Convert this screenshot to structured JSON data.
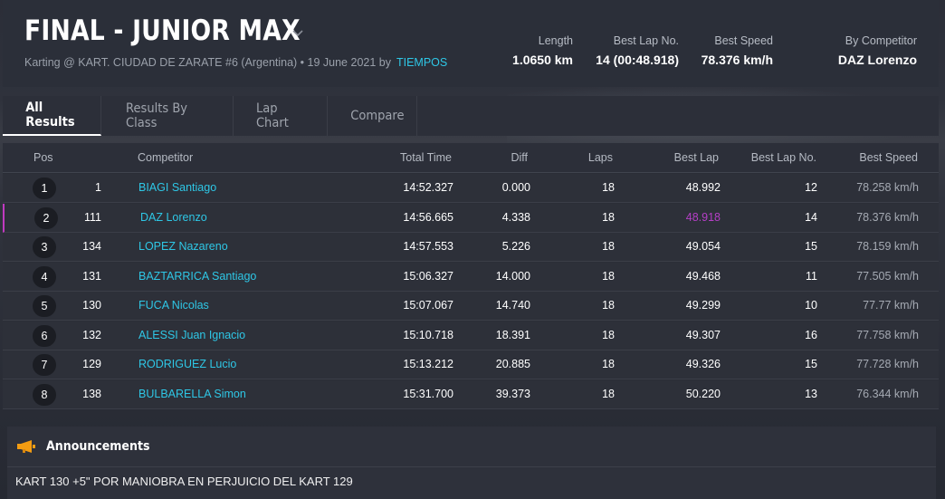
{
  "event": {
    "title": "FINAL - JUNIOR MAX",
    "subtitle": "Karting @ KART. CIUDAD DE ZARATE #6 (Argentina) • 19 June 2021 by",
    "subtitle_link": "TIEMPOS"
  },
  "stats": {
    "length_label": "Length",
    "length_value": "1.0650 km",
    "best_lap_no_label": "Best Lap No.",
    "best_lap_no_value": "14 (00:48.918)",
    "best_speed_label": "Best Speed",
    "best_speed_value": "78.376 km/h",
    "by_competitor_label": "By Competitor",
    "by_competitor_value": "DAZ Lorenzo"
  },
  "tabs": [
    "All Results",
    "Results By Class",
    "Lap Chart",
    "Compare"
  ],
  "table": {
    "headers": {
      "pos": "Pos",
      "competitor": "Competitor",
      "total_time": "Total Time",
      "diff": "Diff",
      "laps": "Laps",
      "best_lap": "Best Lap",
      "best_lap_no": "Best Lap No.",
      "best_speed": "Best Speed"
    },
    "rows": [
      {
        "pos": "1",
        "no": "1",
        "competitor": "BIAGI Santiago",
        "total_time": "14:52.327",
        "diff": "0.000",
        "laps": "18",
        "best_lap": "48.992",
        "best_lap_no": "12",
        "best_speed": "78.258 km/h"
      },
      {
        "pos": "2",
        "no": "111",
        "competitor": "DAZ Lorenzo",
        "total_time": "14:56.665",
        "diff": "4.338",
        "laps": "18",
        "best_lap": "48.918",
        "best_lap_no": "14",
        "best_speed": "78.376 km/h"
      },
      {
        "pos": "3",
        "no": "134",
        "competitor": "LOPEZ Nazareno",
        "total_time": "14:57.553",
        "diff": "5.226",
        "laps": "18",
        "best_lap": "49.054",
        "best_lap_no": "15",
        "best_speed": "78.159 km/h"
      },
      {
        "pos": "4",
        "no": "131",
        "competitor": "BAZTARRICA Santiago",
        "total_time": "15:06.327",
        "diff": "14.000",
        "laps": "18",
        "best_lap": "49.468",
        "best_lap_no": "11",
        "best_speed": "77.505 km/h"
      },
      {
        "pos": "5",
        "no": "130",
        "competitor": "FUCA Nicolas",
        "total_time": "15:07.067",
        "diff": "14.740",
        "laps": "18",
        "best_lap": "49.299",
        "best_lap_no": "10",
        "best_speed": "77.77 km/h"
      },
      {
        "pos": "6",
        "no": "132",
        "competitor": "ALESSI Juan Ignacio",
        "total_time": "15:10.718",
        "diff": "18.391",
        "laps": "18",
        "best_lap": "49.307",
        "best_lap_no": "16",
        "best_speed": "77.758 km/h"
      },
      {
        "pos": "7",
        "no": "129",
        "competitor": "RODRIGUEZ Lucio",
        "total_time": "15:13.212",
        "diff": "20.885",
        "laps": "18",
        "best_lap": "49.326",
        "best_lap_no": "15",
        "best_speed": "77.728 km/h"
      },
      {
        "pos": "8",
        "no": "138",
        "competitor": "BULBARELLA Simon",
        "total_time": "15:31.700",
        "diff": "39.373",
        "laps": "18",
        "best_lap": "50.220",
        "best_lap_no": "13",
        "best_speed": "76.344 km/h"
      }
    ]
  },
  "announcements": {
    "title": "Announcements",
    "icon": "megaphone-icon",
    "text": "KART 130 +5\" POR MANIOBRA EN PERJUICIO DEL KART 129"
  },
  "colors": {
    "link": "#2ec7e6",
    "best_lap_highlight": "#b53fc7",
    "announcement_icon": "#f39c12"
  }
}
